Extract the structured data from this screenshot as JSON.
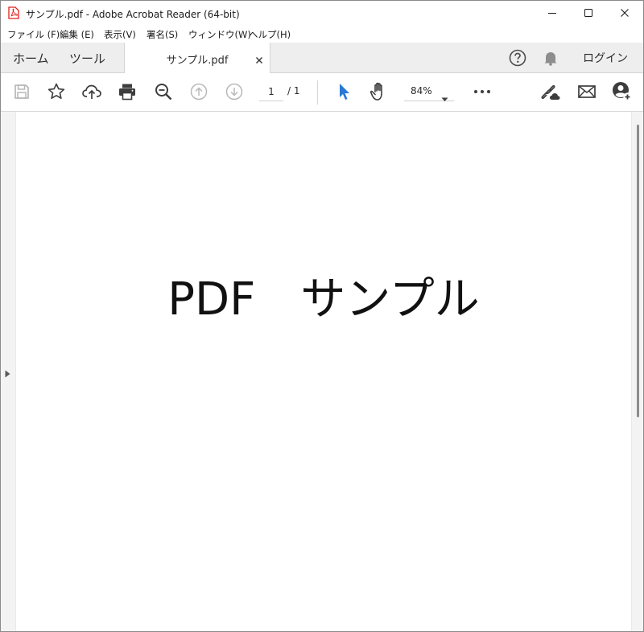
{
  "window": {
    "title": "サンプル.pdf - Adobe Acrobat Reader (64-bit)",
    "icon": "acrobat-pdf-icon"
  },
  "menu": {
    "items": [
      "ファイル (F)",
      "編集 (E)",
      "表示(V)",
      "署名(S)",
      "ウィンドウ(W)",
      "ヘルプ(H)"
    ]
  },
  "tabs": {
    "home": "ホーム",
    "tools": "ツール",
    "document": "サンプル.pdf",
    "login": "ログイン"
  },
  "toolbar": {
    "page_current": "1",
    "page_total": "/ 1",
    "zoom": "84%",
    "icons": [
      "save-icon",
      "star-icon",
      "cloud-upload-icon",
      "print-icon",
      "zoom-search-icon",
      "page-up-icon",
      "page-down-icon",
      "select-cursor-icon",
      "hand-icon",
      "more-icon",
      "share-link-icon",
      "email-icon",
      "add-user-icon"
    ]
  },
  "document": {
    "text": "PDF　サンプル"
  },
  "colors": {
    "accent": "#2a7ad5",
    "pdf_red": "#e0201b",
    "tab_bar": "#eeeeee",
    "doc_background": "#e9e9e9"
  }
}
